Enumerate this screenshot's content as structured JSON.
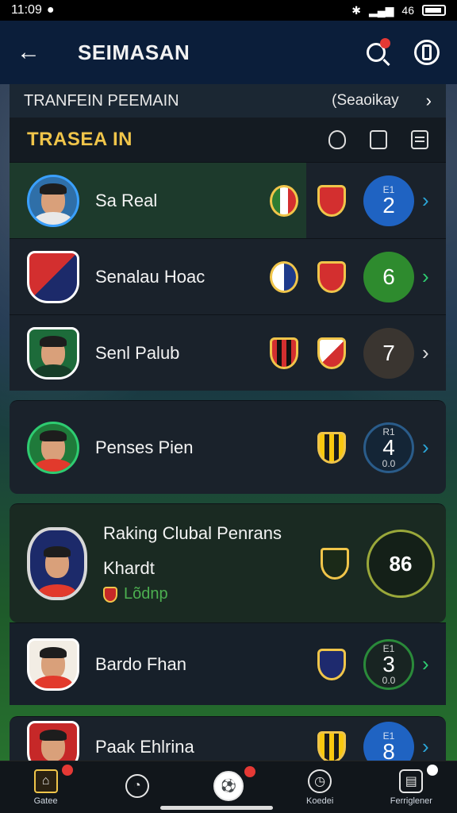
{
  "status": {
    "time": "11:09",
    "right": "46"
  },
  "header": {
    "title": "SEIMASAN"
  },
  "transfer": {
    "label": "TRANFEIN PEEMAIN",
    "season": "(Seaoikay"
  },
  "section": {
    "title": "TRASEA IN"
  },
  "rows": [
    {
      "name": "Sa Real",
      "score": "2",
      "score_top": "E1",
      "score_bottom": ""
    },
    {
      "name": "Senalau Hoac",
      "score": "6",
      "score_top": "",
      "score_bottom": ""
    },
    {
      "name": "Senl Palub",
      "score": "7",
      "score_top": "",
      "score_bottom": ""
    },
    {
      "name": "Penses Pien",
      "score": "4",
      "score_top": "R1",
      "score_bottom": "0.0"
    },
    {
      "name": "Raking Clubal Penrans",
      "sub": "Khardt",
      "club": "Lõdnp",
      "score": "86"
    },
    {
      "name": "Bardo Fhan",
      "score": "3",
      "score_top": "E1",
      "score_bottom": "0.0"
    },
    {
      "name": "Paak Ehlrina",
      "score": "8",
      "score_top": "E1",
      "score_bottom": ""
    }
  ],
  "nav": [
    {
      "label": "Gatee"
    },
    {
      "label": ""
    },
    {
      "label": ""
    },
    {
      "label": "Koedei"
    },
    {
      "label": "Ferriglener"
    }
  ]
}
